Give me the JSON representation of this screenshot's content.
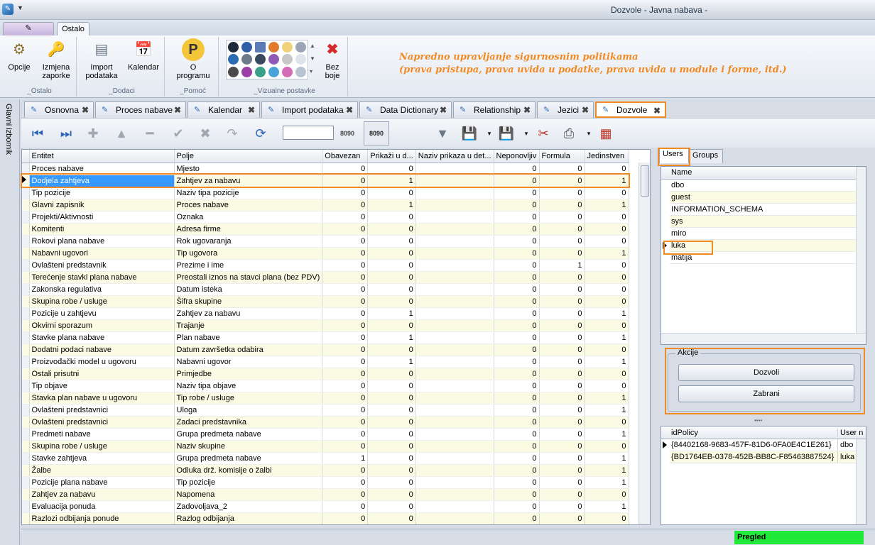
{
  "window": {
    "title": "Dozvole - Javna nabava -"
  },
  "ribbon": {
    "tab": "Ostalo",
    "groups": [
      {
        "label": "_Ostalo",
        "buttons": [
          "Opcije",
          "Izmjena zaporke"
        ]
      },
      {
        "label": "_Dodaci",
        "buttons": [
          "Import podataka",
          "Kalendar"
        ]
      },
      {
        "label": "_Pomoć",
        "buttons": [
          "O programu"
        ]
      },
      {
        "label": "_Vizualne postavke",
        "buttons": [
          "Bez boje"
        ]
      }
    ],
    "note_line1": "Napredno upravljanje sigurnosnim politikama",
    "note_line2": "(prava pristupa, prava uvida u podatke, prava uvida u module i forme, itd.)"
  },
  "sidebar": {
    "label": "Glavni izbornik"
  },
  "doc_tabs": [
    "Osnovna",
    "Proces nabave",
    "Kalendar",
    "Import podataka",
    "Data Dictionary",
    "Relationship",
    "Jezici",
    "Dozvole"
  ],
  "grid": {
    "columns": [
      "Entitet",
      "Polje",
      "Obavezan",
      "Prikaži u d...",
      "Naziv prikaza u det...",
      "Neponovljiv",
      "Formula",
      "Jedinstven"
    ],
    "rows": [
      [
        "Proces nabave",
        "Mjesto",
        "0",
        "0",
        "",
        "0",
        "0",
        "0"
      ],
      [
        "Dodjela zahtjeva",
        "Zahtjev za nabavu",
        "0",
        "1",
        "",
        "0",
        "0",
        "1"
      ],
      [
        "Tip pozicije",
        "Naziv tipa pozicije",
        "0",
        "0",
        "",
        "0",
        "0",
        "0"
      ],
      [
        "Glavni zapisnik",
        "Proces nabave",
        "0",
        "1",
        "",
        "0",
        "0",
        "1"
      ],
      [
        "Projekti/Aktivnosti",
        "Oznaka",
        "0",
        "0",
        "",
        "0",
        "0",
        "0"
      ],
      [
        "Komitenti",
        "Adresa firme",
        "0",
        "0",
        "",
        "0",
        "0",
        "0"
      ],
      [
        "Rokovi plana nabave",
        "Rok ugovaranja",
        "0",
        "0",
        "",
        "0",
        "0",
        "0"
      ],
      [
        "Nabavni ugovori",
        "Tip ugovora",
        "0",
        "0",
        "",
        "0",
        "0",
        "1"
      ],
      [
        "Ovlašteni predstavnik",
        "Prezime i ime",
        "0",
        "0",
        "",
        "0",
        "1",
        "0"
      ],
      [
        "Terećenje stavki plana nabave",
        "Preostali iznos na stavci plana (bez PDV)",
        "0",
        "0",
        "",
        "0",
        "0",
        "0"
      ],
      [
        "Zakonska regulativa",
        "Datum isteka",
        "0",
        "0",
        "",
        "0",
        "0",
        "0"
      ],
      [
        "Skupina robe / usluge",
        "Šifra skupine",
        "0",
        "0",
        "",
        "0",
        "0",
        "0"
      ],
      [
        "Pozicije u zahtjevu",
        "Zahtjev za nabavu",
        "0",
        "1",
        "",
        "0",
        "0",
        "1"
      ],
      [
        "Okvirni sporazum",
        "Trajanje",
        "0",
        "0",
        "",
        "0",
        "0",
        "0"
      ],
      [
        "Stavke plana nabave",
        "Plan nabave",
        "0",
        "1",
        "",
        "0",
        "0",
        "1"
      ],
      [
        "Dodatni podaci nabave",
        "Datum završetka odabira",
        "0",
        "0",
        "",
        "0",
        "0",
        "0"
      ],
      [
        "Proizvođački model u ugovoru",
        "Nabavni ugovor",
        "0",
        "1",
        "",
        "0",
        "0",
        "1"
      ],
      [
        "Ostali prisutni",
        "Primjedbe",
        "0",
        "0",
        "",
        "0",
        "0",
        "0"
      ],
      [
        "Tip objave",
        "Naziv tipa objave",
        "0",
        "0",
        "",
        "0",
        "0",
        "0"
      ],
      [
        "Stavka plan nabave u ugovoru",
        "Tip robe / usluge",
        "0",
        "0",
        "",
        "0",
        "0",
        "1"
      ],
      [
        "Ovlašteni predstavnici",
        "Uloga",
        "0",
        "0",
        "",
        "0",
        "0",
        "1"
      ],
      [
        "Ovlašteni predstavnici",
        "Zadaci predstavnika",
        "0",
        "0",
        "",
        "0",
        "0",
        "0"
      ],
      [
        "Predmeti nabave",
        "Grupa predmeta nabave",
        "0",
        "0",
        "",
        "0",
        "0",
        "1"
      ],
      [
        "Skupina robe / usluge",
        "Naziv skupine",
        "0",
        "0",
        "",
        "0",
        "0",
        "0"
      ],
      [
        "Stavke zahtjeva",
        "Grupa predmeta nabave",
        "1",
        "0",
        "",
        "0",
        "0",
        "1"
      ],
      [
        "Žalbe",
        "Odluka drž. komisije o žalbi",
        "0",
        "0",
        "",
        "0",
        "0",
        "1"
      ],
      [
        "Pozicije plana nabave",
        "Tip pozicije",
        "0",
        "0",
        "",
        "0",
        "0",
        "1"
      ],
      [
        "Zahtjev za nabavu",
        "Napomena",
        "0",
        "0",
        "",
        "0",
        "0",
        "0"
      ],
      [
        "Evaluacija ponuda",
        "Zadovoljava_2",
        "0",
        "0",
        "",
        "0",
        "0",
        "1"
      ],
      [
        "Razlozi odbijanja ponude",
        "Razlog odbijanja",
        "0",
        "0",
        "",
        "0",
        "0",
        "0"
      ]
    ]
  },
  "right_panel": {
    "tabs": [
      "Users",
      "Groups"
    ],
    "users_header": "Name",
    "users": [
      "dbo",
      "guest",
      "INFORMATION_SCHEMA",
      "sys",
      "miro",
      "luka",
      "matija"
    ],
    "akcije_label": "Akcije",
    "dozvoli_label": "Dozvoli",
    "zabrani_label": "Zabrani",
    "policy_columns": [
      "idPolicy",
      "User n"
    ],
    "policies": [
      [
        "{84402168-9683-457F-81D6-0FA0E4C1E261}",
        "dbo"
      ],
      [
        "{BD1764EB-0378-452B-BB8C-F85463887524}",
        "luka"
      ]
    ]
  },
  "status": {
    "mode": "Pregled"
  },
  "colors": {
    "accent": "#f08a24",
    "selection": "#3399ff",
    "status_ok": "#22e83a",
    "alt_row": "#fbfbe3"
  }
}
